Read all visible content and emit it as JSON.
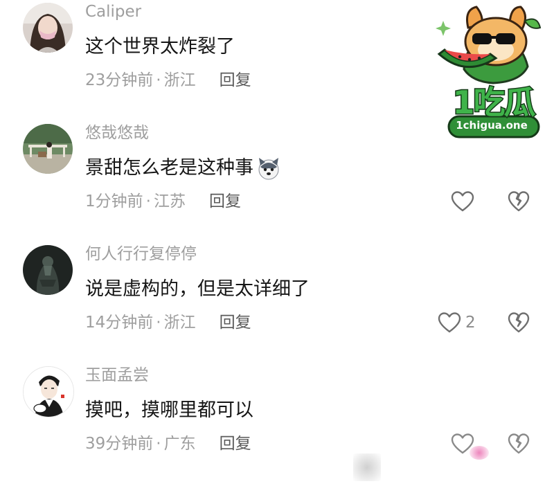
{
  "comments": [
    {
      "username": "Caliper",
      "text": "这个世界太炸裂了",
      "time": "23分钟前",
      "location": "浙江",
      "reply_label": "回复",
      "likes": "",
      "avatar_icon": "woman-with-mask-avatar"
    },
    {
      "username": "悠哉悠哉",
      "text": "景甜怎么老是这种事",
      "time": "1分钟前",
      "location": "江苏",
      "reply_label": "回复",
      "likes": "",
      "avatar_icon": "outdoor-scene-avatar",
      "inline_emoji": "husky-dog-emoji"
    },
    {
      "username": "何人行行复停停",
      "text": "说是虚构的，但是太详细了",
      "time": "14分钟前",
      "location": "浙江",
      "reply_label": "回复",
      "likes": "2",
      "avatar_icon": "dark-figure-avatar"
    },
    {
      "username": "玉面孟尝",
      "text": "摸吧，摸哪里都可以",
      "time": "39分钟前",
      "location": "广东",
      "reply_label": "回复",
      "likes": "",
      "avatar_icon": "cartoon-man-avatar"
    }
  ],
  "separator": "·",
  "watermark": {
    "word": "1吃瓜",
    "site": "1chigua.one",
    "icon": "hamster-eating-watermelon-logo"
  },
  "colors": {
    "muted_text": "#9e9e9e",
    "main_text": "#161616",
    "reply_text": "#5a5a5a",
    "logo_green": "#3fb34a"
  }
}
